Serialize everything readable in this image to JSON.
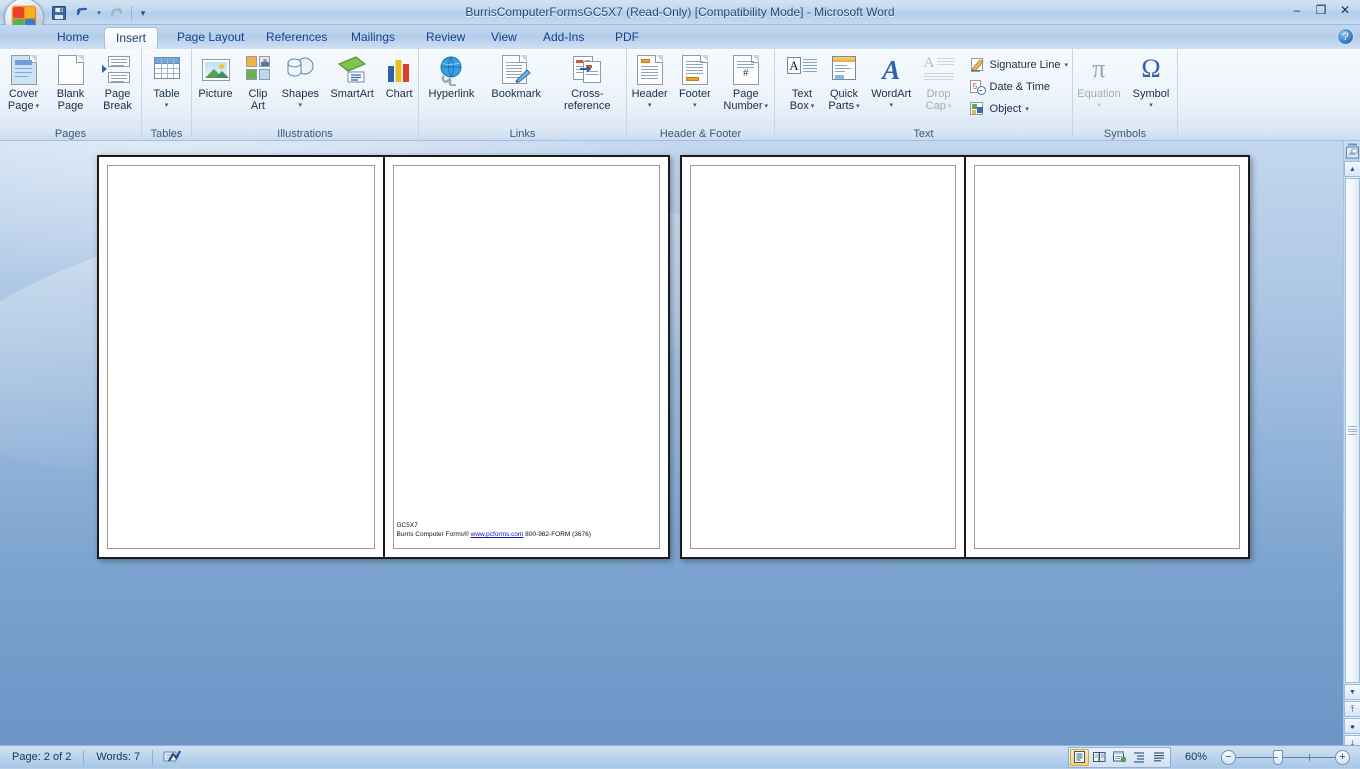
{
  "window": {
    "title": "BurrisComputerFormsGC5X7 (Read-Only) [Compatibility Mode] - Microsoft Word",
    "minimize_label": "–",
    "restore_label": "❐",
    "close_label": "✕",
    "office_button_label": "Office Button"
  },
  "quick_access": {
    "save_label": "Save",
    "undo_label": "Undo",
    "undo_caret": "▾",
    "redo_label": "Redo",
    "customize_label": "▾"
  },
  "ribbon": {
    "help_label": "?",
    "tabs": [
      {
        "label": "Home",
        "active": false
      },
      {
        "label": "Insert",
        "active": true
      },
      {
        "label": "Page Layout",
        "active": false
      },
      {
        "label": "References",
        "active": false
      },
      {
        "label": "Mailings",
        "active": false
      },
      {
        "label": "Review",
        "active": false
      },
      {
        "label": "View",
        "active": false
      },
      {
        "label": "Add-Ins",
        "active": false
      },
      {
        "label": "PDF",
        "active": false
      }
    ],
    "groups": [
      {
        "name": "Pages",
        "label": "Pages",
        "items": [
          {
            "label": "Cover\nPage",
            "line1": "Cover",
            "line2": "Page",
            "caret": "▾",
            "icon": "cover-page-icon"
          },
          {
            "label": "Blank\nPage",
            "line1": "Blank",
            "line2": "Page",
            "caret": "",
            "icon": "blank-page-icon"
          },
          {
            "label": "Page\nBreak",
            "line1": "Page",
            "line2": "Break",
            "caret": "",
            "icon": "page-break-icon"
          }
        ]
      },
      {
        "name": "Tables",
        "label": "Tables",
        "items": [
          {
            "line1": "Table",
            "line2": "",
            "caret": "▾",
            "icon": "table-icon"
          }
        ]
      },
      {
        "name": "Illustrations",
        "label": "Illustrations",
        "items": [
          {
            "line1": "Picture",
            "line2": "",
            "caret": "",
            "icon": "picture-icon"
          },
          {
            "line1": "Clip",
            "line2": "Art",
            "caret": "",
            "icon": "clip-art-icon"
          },
          {
            "line1": "Shapes",
            "line2": "",
            "caret": "▾",
            "icon": "shapes-icon"
          },
          {
            "line1": "SmartArt",
            "line2": "",
            "caret": "",
            "icon": "smartart-icon"
          },
          {
            "line1": "Chart",
            "line2": "",
            "caret": "",
            "icon": "chart-icon"
          }
        ]
      },
      {
        "name": "Links",
        "label": "Links",
        "items": [
          {
            "line1": "Hyperlink",
            "line2": "",
            "caret": "",
            "icon": "hyperlink-icon"
          },
          {
            "line1": "Bookmark",
            "line2": "",
            "caret": "",
            "icon": "bookmark-icon"
          },
          {
            "line1": "Cross-reference",
            "line2": "",
            "caret": "",
            "icon": "cross-reference-icon"
          }
        ]
      },
      {
        "name": "Header & Footer",
        "label": "Header & Footer",
        "items": [
          {
            "line1": "Header",
            "line2": "",
            "caret": "▾",
            "icon": "header-icon"
          },
          {
            "line1": "Footer",
            "line2": "",
            "caret": "▾",
            "icon": "footer-icon"
          },
          {
            "line1": "Page",
            "line2": "Number",
            "caret": "▾",
            "icon": "page-number-icon"
          }
        ]
      },
      {
        "name": "Text",
        "label": "Text",
        "items": [
          {
            "line1": "Text",
            "line2": "Box",
            "caret": "▾",
            "icon": "text-box-icon"
          },
          {
            "line1": "Quick",
            "line2": "Parts",
            "caret": "▾",
            "icon": "quick-parts-icon"
          },
          {
            "line1": "WordArt",
            "line2": "",
            "caret": "▾",
            "icon": "wordart-icon"
          },
          {
            "line1": "Drop",
            "line2": "Cap",
            "caret": "▾",
            "icon": "drop-cap-icon",
            "disabled": true
          }
        ],
        "small_items": [
          {
            "label": "Signature Line",
            "caret": "▾",
            "icon": "signature-line-icon"
          },
          {
            "label": "Date & Time",
            "caret": "",
            "icon": "date-time-icon"
          },
          {
            "label": "Object",
            "caret": "▾",
            "icon": "object-icon"
          }
        ]
      },
      {
        "name": "Symbols",
        "label": "Symbols",
        "items": [
          {
            "line1": "Equation",
            "line2": "",
            "caret": "▾",
            "icon": "equation-icon",
            "glyph": "π",
            "disabled": true
          },
          {
            "line1": "Symbol",
            "line2": "",
            "caret": "▾",
            "icon": "symbol-icon",
            "glyph": "Ω"
          }
        ]
      }
    ]
  },
  "document": {
    "footer_line1": "GC5X7",
    "footer_prefix": "Burris Computer Forms® ",
    "footer_link": "www.pcforms.com",
    "footer_suffix": " 800-982-FORM (3676)"
  },
  "scrollbar": {
    "up_label": "▲",
    "down_label": "▼",
    "select_object_label": "Select Browse Object",
    "prev_page_label": "⤒",
    "browse_label": "●",
    "next_page_label": "⤓"
  },
  "statusbar": {
    "page_label": "Page: 2 of 2",
    "words_label": "Words: 7",
    "proofing_label": "Proofing errors",
    "zoom_pct": "60%",
    "zoom_out_label": "−",
    "zoom_in_label": "+",
    "views": [
      {
        "name": "print-layout",
        "glyph": "☰",
        "active": true
      },
      {
        "name": "full-screen-reading",
        "glyph": "☷",
        "active": false
      },
      {
        "name": "web-layout",
        "glyph": "▤",
        "active": false
      },
      {
        "name": "outline",
        "glyph": "≡",
        "active": false
      },
      {
        "name": "draft",
        "glyph": "≣",
        "active": false
      }
    ]
  },
  "colors": {
    "accent": "#15428b",
    "ribbon_bg": "#eef4fb",
    "workspace_top": "#c3d7ef",
    "workspace_bottom": "#6b95c6",
    "link": "#1414c8"
  }
}
